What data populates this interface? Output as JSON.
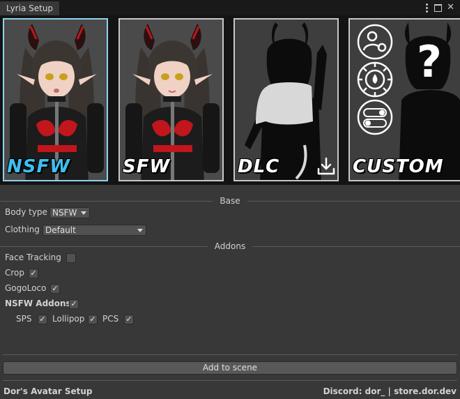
{
  "window": {
    "tab_title": "Lyria Setup"
  },
  "cards": [
    {
      "label": "NSFW",
      "selected": true
    },
    {
      "label": "SFW",
      "selected": false
    },
    {
      "label": "DLC",
      "selected": false
    },
    {
      "label": "CUSTOM",
      "selected": false
    }
  ],
  "colors": {
    "selected_border": "#8fd3ef",
    "selected_label": "#3fbfee",
    "panel_bg": "#383838"
  },
  "base": {
    "header": "Base",
    "body_type_label": "Body type",
    "body_type_value": "NSFW",
    "clothing_label": "Clothing",
    "clothing_value": "Default"
  },
  "addons": {
    "header": "Addons",
    "face_tracking_label": "Face Tracking",
    "face_tracking_checked": false,
    "crop_label": "Crop",
    "crop_checked": true,
    "gogoloco_label": "GogoLoco",
    "gogoloco_checked": true,
    "nsfw_addons_label": "NSFW Addons",
    "nsfw_addons_checked": true,
    "sps_label": "SPS",
    "sps_checked": true,
    "lollipop_label": "Lollipop",
    "lollipop_checked": true,
    "pcs_label": "PCS",
    "pcs_checked": true,
    "checkmark": "✓"
  },
  "actions": {
    "add_to_scene_label": "Add to scene"
  },
  "footer": {
    "left_text": "Dor's Avatar Setup",
    "right_text": "Discord: dor_ | store.dor.dev"
  }
}
